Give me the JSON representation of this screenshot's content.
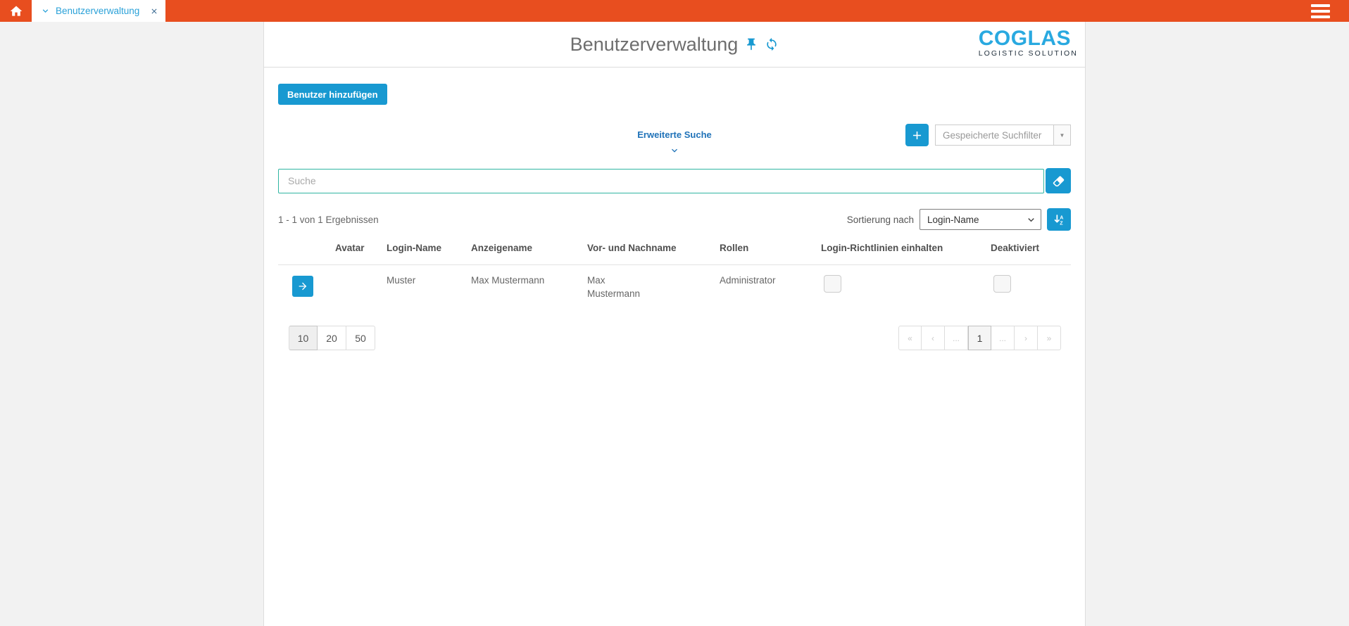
{
  "colors": {
    "topbar_orange": "#E84E1F",
    "primary_blue": "#1899D1",
    "logo_blue": "#29A9E0",
    "logo_tagline_dark": "#22303D",
    "advanced_link_blue": "#1F72B8",
    "search_border_teal": "#2FB5A2",
    "tab_label_blue": "#2AA1D8"
  },
  "topbar": {
    "tab": {
      "label": "Benutzerverwaltung"
    }
  },
  "header": {
    "title": "Benutzerverwaltung",
    "logo_name": "COGLAS",
    "logo_tagline": "LOGISTIC SOLUTION"
  },
  "toolbar": {
    "add_user_label": "Benutzer hinzufügen",
    "advanced_search_label": "Erweiterte Suche",
    "saved_filters_placeholder": "Gespeicherte Suchfilter"
  },
  "search": {
    "placeholder": "Suche",
    "value": ""
  },
  "results": {
    "summary": "1 - 1 von 1 Ergebnissen",
    "sort_label": "Sortierung nach",
    "sort_value": "Login-Name"
  },
  "table": {
    "headers": [
      "Avatar",
      "Login-Name",
      "Anzeigename",
      "Vor- und Nachname",
      "Rollen",
      "Login-Richtlinien einhalten",
      "Deaktiviert"
    ],
    "rows": [
      {
        "avatar": "",
        "login_name": "Muster",
        "display_name": "Max Mustermann",
        "full_name": "Max Mustermann",
        "roles": "Administrator",
        "login_policy_checked": false,
        "deactivated_checked": false
      }
    ]
  },
  "pagination": {
    "page_sizes": [
      "10",
      "20",
      "50"
    ],
    "active_page_size": "10",
    "nav": [
      "«",
      "‹",
      "...",
      "1",
      "...",
      "›",
      "»"
    ],
    "active_page": "1"
  }
}
